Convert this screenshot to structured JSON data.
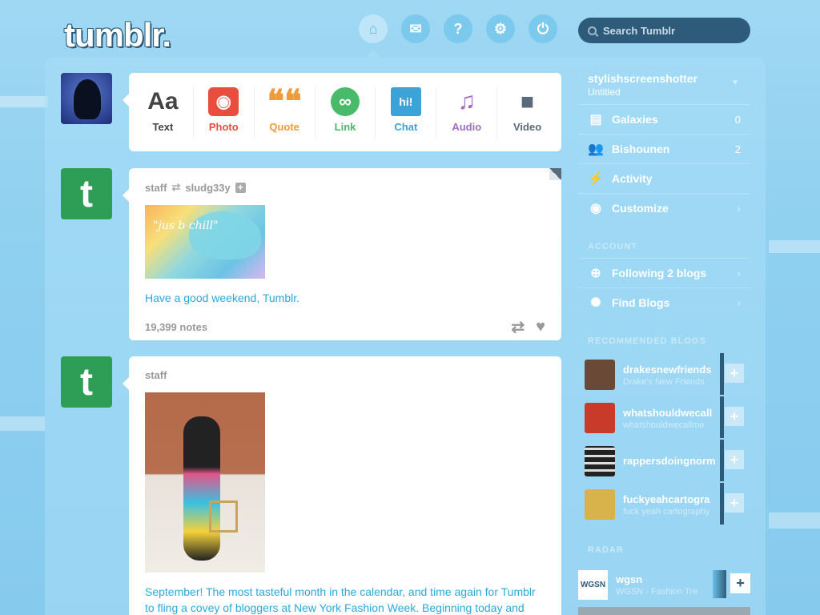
{
  "header": {
    "logo": "tumblr.",
    "search_placeholder": "Search Tumblr",
    "nav": [
      {
        "icon": "home-icon",
        "glyph": "⌂"
      },
      {
        "icon": "mail-icon",
        "glyph": "✉"
      },
      {
        "icon": "help-icon",
        "glyph": "?"
      },
      {
        "icon": "gear-icon",
        "glyph": "⚙"
      },
      {
        "icon": "power-icon",
        "glyph": "⏻"
      }
    ]
  },
  "composer": {
    "types": [
      {
        "label": "Text",
        "glyph": "Aa",
        "color": "#444444"
      },
      {
        "label": "Photo",
        "glyph": "◉",
        "color": "#e84d3d"
      },
      {
        "label": "Quote",
        "glyph": "❝❝",
        "color": "#f09b3a"
      },
      {
        "label": "Link",
        "glyph": "∞",
        "color": "#49b96a"
      },
      {
        "label": "Chat",
        "glyph": "hi!",
        "color": "#3ca3d9"
      },
      {
        "label": "Audio",
        "glyph": "♫",
        "color": "#a46bc6"
      },
      {
        "label": "Video",
        "glyph": "■",
        "color": "#5b6a78"
      }
    ]
  },
  "posts": [
    {
      "author": "staff",
      "reblogged_from": "sludg33y",
      "image_text": "\"jus b chill\"",
      "body": "Have a good weekend, Tumblr.",
      "notes": "19,399 notes"
    },
    {
      "author": "staff",
      "body": "September! The most tasteful month in the calendar, and time again for Tumblr to fling a covey of bloggers at New York Fashion Week. Beginning today and"
    }
  ],
  "sidebar": {
    "blog_name": "stylishscreenshotter",
    "blog_title": "Untitled",
    "items": [
      {
        "label": "Galaxies",
        "count": "0",
        "icon": "posts-icon",
        "glyph": "▤"
      },
      {
        "label": "Bishounen",
        "count": "2",
        "icon": "followers-icon",
        "glyph": "👥"
      },
      {
        "label": "Activity",
        "count": "",
        "icon": "activity-icon",
        "glyph": "⚡"
      },
      {
        "label": "Customize",
        "count": "",
        "icon": "eye-icon",
        "glyph": "◉",
        "chevron": "›"
      }
    ],
    "account_title": "ACCOUNT",
    "account_items": [
      {
        "label": "Following 2 blogs",
        "icon": "following-icon",
        "glyph": "⊕",
        "chevron": "›"
      },
      {
        "label": "Find Blogs",
        "icon": "find-blogs-icon",
        "glyph": "✺",
        "chevron": "›"
      }
    ],
    "recommended_title": "RECOMMENDED BLOGS",
    "recommended": [
      {
        "name": "drakesnewfriends",
        "desc": "Drake's New Friends",
        "color": "#6a4a36"
      },
      {
        "name": "whatshouldwecall",
        "desc": "whatshouldwecallme",
        "color": "#c93a2a"
      },
      {
        "name": "rappersdoingnorm",
        "desc": "",
        "color": "#333333"
      },
      {
        "name": "fuckyeahcartogra",
        "desc": "fuck yeah cartography",
        "color": "#d8b24a"
      }
    ],
    "radar_title": "RADAR",
    "radar": {
      "name": "wgsn",
      "desc": "WGSN - Fashion Tre",
      "logo": "WGSN"
    }
  }
}
